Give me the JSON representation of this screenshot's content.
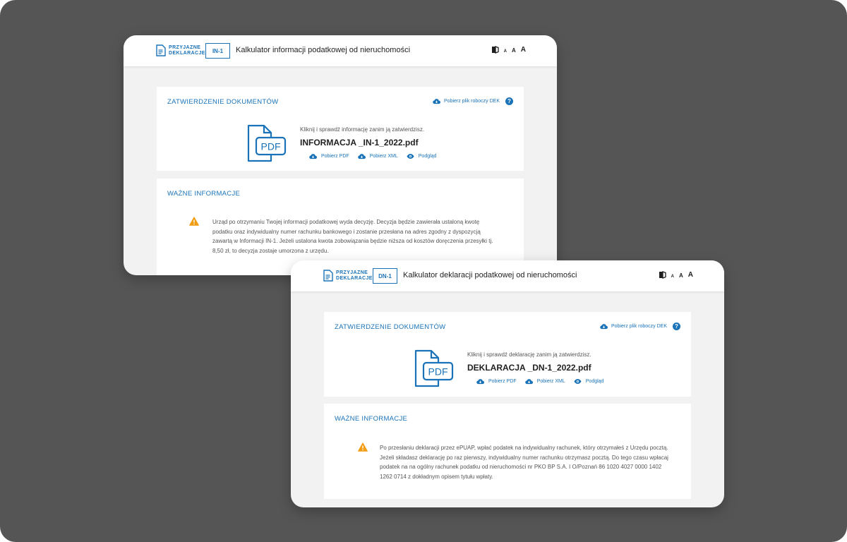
{
  "logo": {
    "line1": "PRZYJAZNE",
    "line2": "DEKLARACJE"
  },
  "accessibility": {
    "font_small": "A",
    "font_medium": "A",
    "font_large": "A"
  },
  "colors": {
    "accent": "#1a73b8",
    "warning": "#f39c12",
    "background": "#555555"
  },
  "windows": [
    {
      "code": "IN-1",
      "title": "Kalkulator informacji podatkowej od nieruchomości",
      "docs": {
        "title": "ZATWIERDZENIE DOKUMENTÓW",
        "draft_link": "Pobierz plik roboczy DEK",
        "instruction": "Kliknij i sprawdź informację zanim ją zatwierdzisz.",
        "filename": "INFORMACJA _IN-1_2022.pdf",
        "pdf_label": "PDF",
        "actions": {
          "pdf": "Pobierz PDF",
          "xml": "Pobierz XML",
          "preview": "Podgląd"
        }
      },
      "info": {
        "title": "WAŻNE INFORMACJE",
        "text": "Urząd po otrzymaniu Twojej informacji podatkowej wyda decyzję. Decyzja będzie zawierała ustaloną kwotę podatku oraz indywidualny numer rachunku bankowego i zostanie przesłana na adres zgodny z dyspozycją zawartą w Informacji IN-1. Jeżeli ustalona kwota zobowiązania będzie niższa od kosztów doręczenia przesyłki tj. 8,50 zł, to decyzja zostaje umorzona z urzędu."
      }
    },
    {
      "code": "DN-1",
      "title": "Kalkulator deklaracji podatkowej od nieruchomości",
      "docs": {
        "title": "ZATWIERDZENIE DOKUMENTÓW",
        "draft_link": "Pobierz plik roboczy DEK",
        "instruction": "Kliknij i sprawdź deklarację zanim ją zatwierdzisz.",
        "filename": "DEKLARACJA _DN-1_2022.pdf",
        "pdf_label": "PDF",
        "actions": {
          "pdf": "Pobierz PDF",
          "xml": "Pobierz XML",
          "preview": "Podgląd"
        }
      },
      "info": {
        "title": "WAŻNE INFORMACJE",
        "text": "Po przesłaniu deklaracji przez ePUAP, wpłać podatek na indywidualny rachunek, który otrzymałeś z Urzędu pocztą. Jeżeli składasz deklarację po raz pierwszy, indywidualny numer rachunku otrzymasz pocztą. Do tego czasu wpłacaj podatek na na ogólny rachunek podatku od nieruchomości nr PKO BP S.A. I O/Poznań 86 1020 4027 0000 1402 1262 0714 z dokładnym opisem tytułu wpłaty."
      }
    }
  ]
}
